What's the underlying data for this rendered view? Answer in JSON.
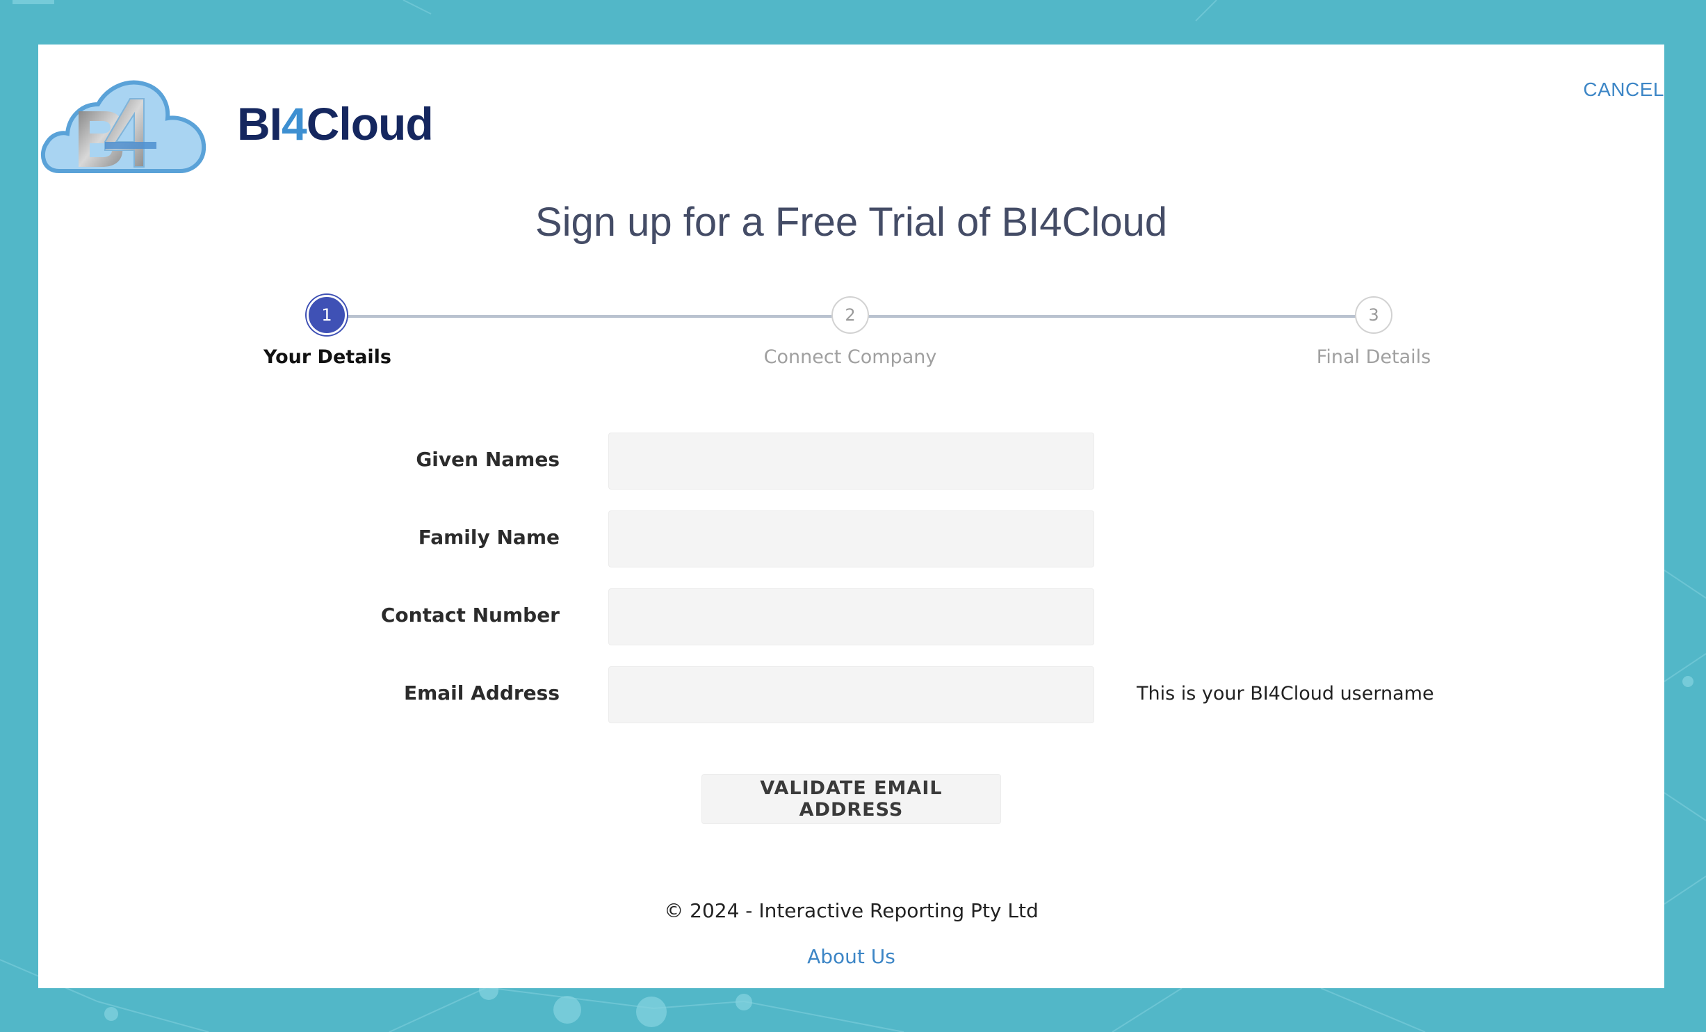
{
  "colors": {
    "background": "#52b7c8",
    "card": "#ffffff",
    "brand_dark": "#15275f",
    "brand_light": "#3d8fd1",
    "step_active": "#3f51b5",
    "link": "#3d86c6",
    "title": "#444c66"
  },
  "header": {
    "logo_icon": "bi4-cloud-logo",
    "logo_text_a": "BI",
    "logo_text_b": "4",
    "logo_text_c": "Cloud",
    "cancel_label": "CANCEL"
  },
  "main": {
    "title": "Sign up for a Free Trial of BI4Cloud",
    "steps": [
      {
        "number": "1",
        "label": "Your Details",
        "active": true
      },
      {
        "number": "2",
        "label": "Connect Company",
        "active": false
      },
      {
        "number": "3",
        "label": "Final Details",
        "active": false
      }
    ],
    "form": {
      "given_names_label": "Given Names",
      "given_names_value": "",
      "family_name_label": "Family Name",
      "family_name_value": "",
      "contact_number_label": "Contact Number",
      "contact_number_value": "",
      "email_label": "Email Address",
      "email_value": "",
      "email_hint": "This is your BI4Cloud username"
    },
    "validate_label": "VALIDATE EMAIL ADDRESS"
  },
  "footer": {
    "copyright": "© 2024 - Interactive Reporting Pty Ltd",
    "about_label": "About Us"
  }
}
